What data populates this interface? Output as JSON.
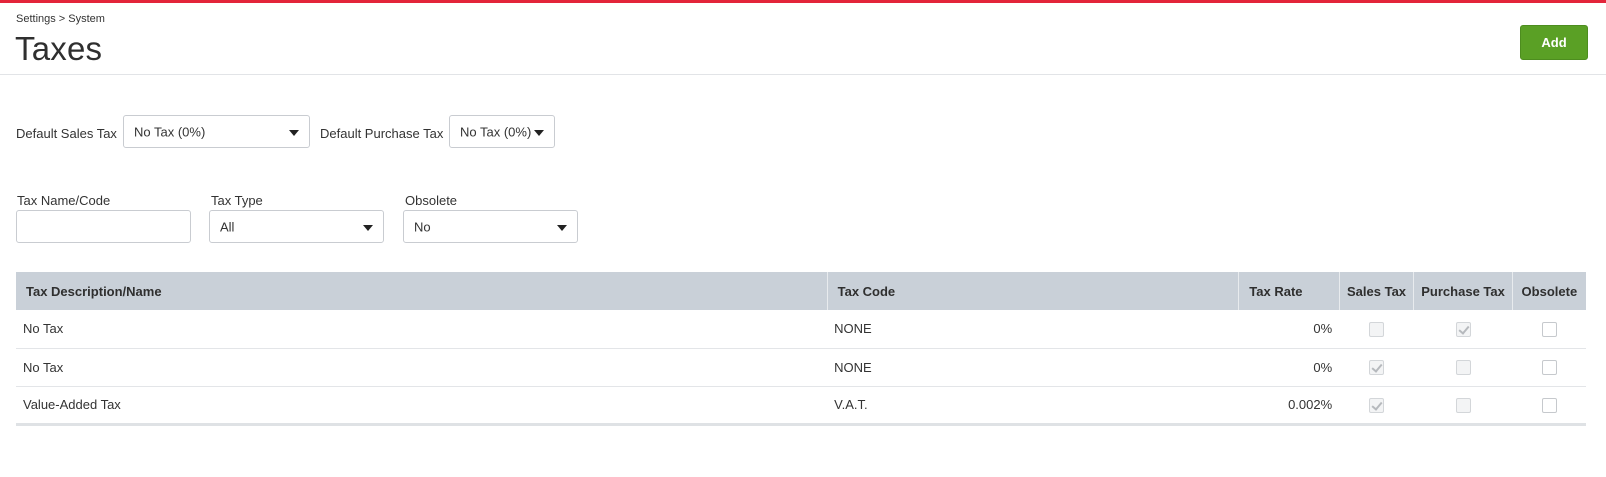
{
  "breadcrumb": "Settings > System",
  "title": "Taxes",
  "add_label": "Add",
  "colors": {
    "accent_bar": "#e3243a",
    "add_button": "#5aa025",
    "table_header": "#c9d0d8"
  },
  "defaults": {
    "sales_label": "Default Sales Tax",
    "sales_value": "No Tax (0%)",
    "purchase_label": "Default Purchase Tax",
    "purchase_value": "No Tax (0%)"
  },
  "filters": {
    "name_label": "Tax Name/Code",
    "name_value": "",
    "type_label": "Tax Type",
    "type_value": "All",
    "obsolete_label": "Obsolete",
    "obsolete_value": "No"
  },
  "table": {
    "columns": [
      "Tax Description/Name",
      "Tax Code",
      "Tax Rate",
      "Sales Tax",
      "Purchase Tax",
      "Obsolete"
    ],
    "rows": [
      {
        "name": "No Tax",
        "code": "NONE",
        "rate": "0%",
        "sales": false,
        "purchase": true,
        "obsolete": false
      },
      {
        "name": "No Tax",
        "code": "NONE",
        "rate": "0%",
        "sales": true,
        "purchase": false,
        "obsolete": false
      },
      {
        "name": "Value-Added Tax",
        "code": "V.A.T.",
        "rate": "0.002%",
        "sales": true,
        "purchase": false,
        "obsolete": false
      }
    ]
  }
}
